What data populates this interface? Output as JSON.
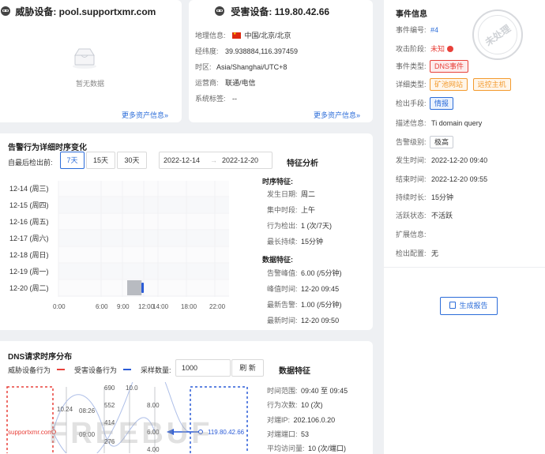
{
  "threat": {
    "title": "威胁设备: pool.supportxmr.com",
    "empty": "暂无数据",
    "more": "更多资产信息»"
  },
  "victim": {
    "title": "受害设备: 119.80.42.66",
    "rows": [
      {
        "label": "地理信息:",
        "value": "中国/北京/北京"
      },
      {
        "label": "经纬度:",
        "value": "39.938884,116.397459"
      },
      {
        "label": "时区:",
        "value": "Asia/Shanghai/UTC+8"
      },
      {
        "label": "运营商:",
        "value": "联通/电信"
      },
      {
        "label": "系统标签:",
        "value": "--"
      }
    ],
    "more": "更多资产信息»"
  },
  "event": {
    "title": "事件信息",
    "stamp": "未处理",
    "rows": [
      {
        "label": "事件编号:",
        "value": "#4"
      },
      {
        "label": "攻击阶段:",
        "value": "未知"
      },
      {
        "label": "事件类型:",
        "value": "DNS事件"
      },
      {
        "label": "详细类型:",
        "value": "矿池网站",
        "value2": "远控主机"
      },
      {
        "label": "检出手段:",
        "value": "情报"
      },
      {
        "label": "描述信息:",
        "value": "Ti domain query"
      },
      {
        "label": "告警级别:",
        "value": "极高"
      },
      {
        "label": "发生时间:",
        "value": "2022-12-20 09:40"
      },
      {
        "label": "结束时间:",
        "value": "2022-12-20 09:55"
      },
      {
        "label": "持续时长:",
        "value": "15分钟"
      },
      {
        "label": "活跃状态:",
        "value": "不活跃"
      },
      {
        "label": "扩展信息:",
        "value": ""
      },
      {
        "label": "检出配置:",
        "value": "无"
      }
    ],
    "report_button": "生成报告"
  },
  "timeline": {
    "title": "告警行为详细时序变化",
    "recent_label": "自最后检出前:",
    "ranges": [
      "7天",
      "15天",
      "30天"
    ],
    "date_start": "2022-12-14",
    "date_arrow": "→",
    "date_end": "2022-12-20",
    "feature_title": "特征分析",
    "days": [
      "12-14 (周三)",
      "12-15 (周四)",
      "12-16 (周五)",
      "12-17 (周六)",
      "12-18 (周日)",
      "12-19 (周一)",
      "12-20 (周二)"
    ],
    "hours": [
      "0:00",
      "6:00",
      "9:00",
      "12:00",
      "14:00",
      "18:00",
      "22:00"
    ],
    "hour_values": [
      0,
      6,
      9,
      12,
      14,
      18,
      22
    ],
    "activity": {
      "day_index": 6,
      "start_hour": 9.67,
      "end_hour": 9.92
    },
    "timing_title": "时序特征:",
    "timing": [
      {
        "label": "发生日期:",
        "value": "周二"
      },
      {
        "label": "集中时段:",
        "value": "上午"
      },
      {
        "label": "行为检出:",
        "value": "1 (次/7天)"
      },
      {
        "label": "最长持续:",
        "value": "15分钟"
      }
    ],
    "data_title": "数据特征:",
    "data": [
      {
        "label": "告警峰值:",
        "value": "6.00 (/5分钟)"
      },
      {
        "label": "峰值时间:",
        "value": "12-20 09:45"
      },
      {
        "label": "最新告警:",
        "value": "1.00 (/5分钟)"
      },
      {
        "label": "最新时间:",
        "value": "12-20 09:50"
      }
    ]
  },
  "dns": {
    "title": "DNS请求时序分布",
    "legend_threat": "威胁设备行为",
    "legend_victim": "受害设备行为",
    "sample_label": "采样数量:",
    "sample_value": "1000",
    "refresh": "刷 新",
    "feature_title": "数据特征",
    "axis_labels": [
      "10.24",
      "08:26",
      "09:00",
      "690",
      "552",
      "414",
      "276",
      "10.0",
      "8.00",
      "6.00",
      "4.00"
    ],
    "threat_node": "supportxmr.com",
    "victim_node": "119.80.42.66",
    "rows": [
      {
        "label": "时间范围:",
        "value": "09:40 至 09:45"
      },
      {
        "label": "行为次数:",
        "value": "10 (次)"
      },
      {
        "label": "对端IP:",
        "value": "202.106.0.20"
      },
      {
        "label": "对端端口:",
        "value": "53"
      },
      {
        "label": "平均访问量:",
        "value": "10 (次/端口)"
      }
    ],
    "watermark": "FREEBUF"
  },
  "colors": {
    "accent": "#2b6cd9",
    "threat": "#e8413a",
    "victim": "#2a5bd7",
    "tag_red": "#e8413a",
    "tag_orange": "#f39a2d"
  }
}
